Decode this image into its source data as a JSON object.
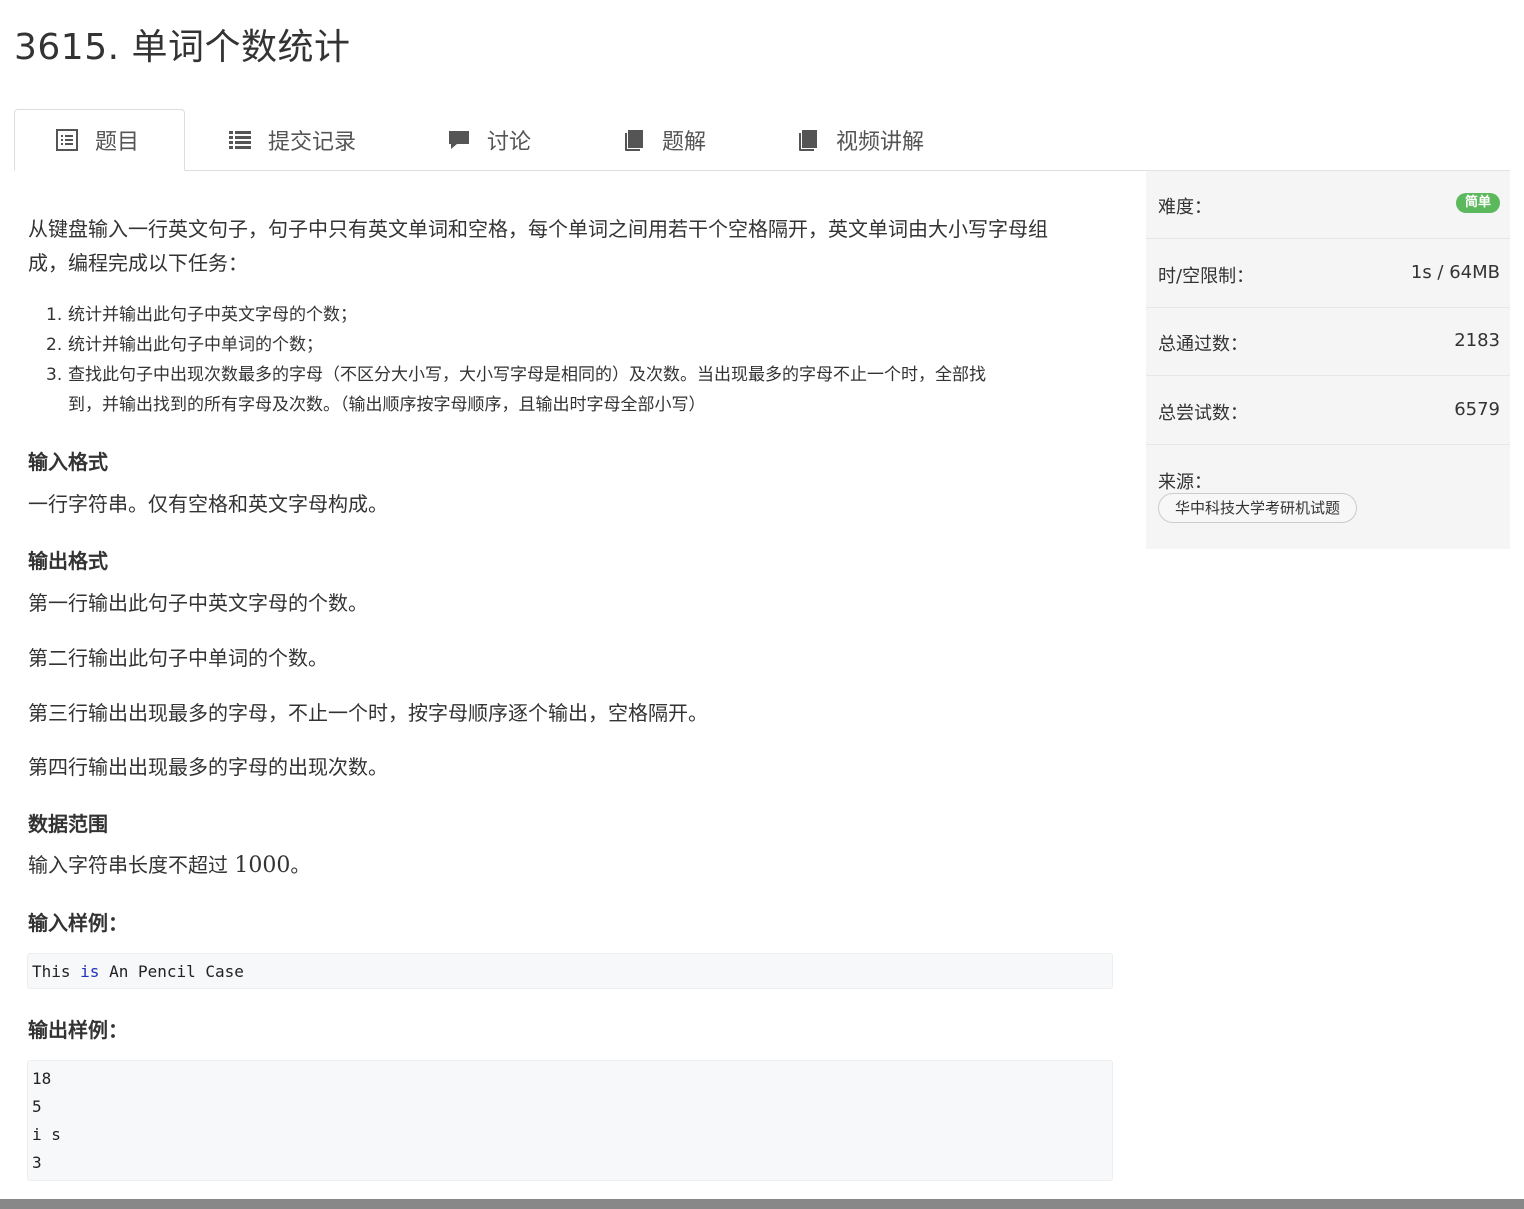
{
  "problem": {
    "number": "3615.",
    "title": "单词个数统计"
  },
  "tabs": [
    {
      "label": "题目",
      "icon": "list-alt-icon"
    },
    {
      "label": "提交记录",
      "icon": "list-icon"
    },
    {
      "label": "讨论",
      "icon": "comment-icon"
    },
    {
      "label": "题解",
      "icon": "book-icon"
    },
    {
      "label": "视频讲解",
      "icon": "book-icon"
    }
  ],
  "content": {
    "intro_line1": "从键盘输入一行英文句子，句子中只有英文单词和空格，每个单词之间用若干个空格隔开，英文单词由大小写字母组",
    "intro_line2": "成，编程完成以下任务：",
    "tasks": [
      {
        "num": "1.",
        "text": "统计并输出此句子中英文字母的个数；"
      },
      {
        "num": "2.",
        "text": "统计并输出此句子中单词的个数；"
      },
      {
        "num": "3.",
        "text_line1": "查找此句子中出现次数最多的字母（不区分大小写，大小写字母是相同的）及次数。当出现最多的字母不止一个时，全部找",
        "text_line2": "到，并输出找到的所有字母及次数。（输出顺序按字母顺序，且输出时字母全部小写）"
      }
    ],
    "input_format_heading": "输入格式",
    "input_format_text": "一行字符串。仅有空格和英文字母构成。",
    "output_format_heading": "输出格式",
    "output_lines": [
      "第一行输出此句子中英文字母的个数。",
      "第二行输出此句子中单词的个数。",
      "第三行输出出现最多的字母，不止一个时，按字母顺序逐个输出，空格隔开。",
      "第四行输出出现最多的字母的出现次数。"
    ],
    "range_heading": "数据范围",
    "range_text_prefix": "输入字符串长度不超过 ",
    "range_text_number": "1000",
    "range_text_suffix": "。",
    "sample_input_heading": "输入样例：",
    "sample_input": {
      "part1": "This ",
      "keyword": "is",
      "part2": " An Pencil Case"
    },
    "sample_output_heading": "输出样例：",
    "sample_output_lines": [
      "18",
      "5",
      "i s",
      "3"
    ]
  },
  "sidebar": {
    "difficulty_label": "难度：",
    "difficulty_value": "简单",
    "difficulty_color": "#5cb85c",
    "limit_label": "时/空限制：",
    "limit_value": "1s / 64MB",
    "passed_label": "总通过数：",
    "passed_value": "2183",
    "tried_label": "总尝试数：",
    "tried_value": "6579",
    "source_label": "来源：",
    "source_value": "华中科技大学考研机试题"
  }
}
